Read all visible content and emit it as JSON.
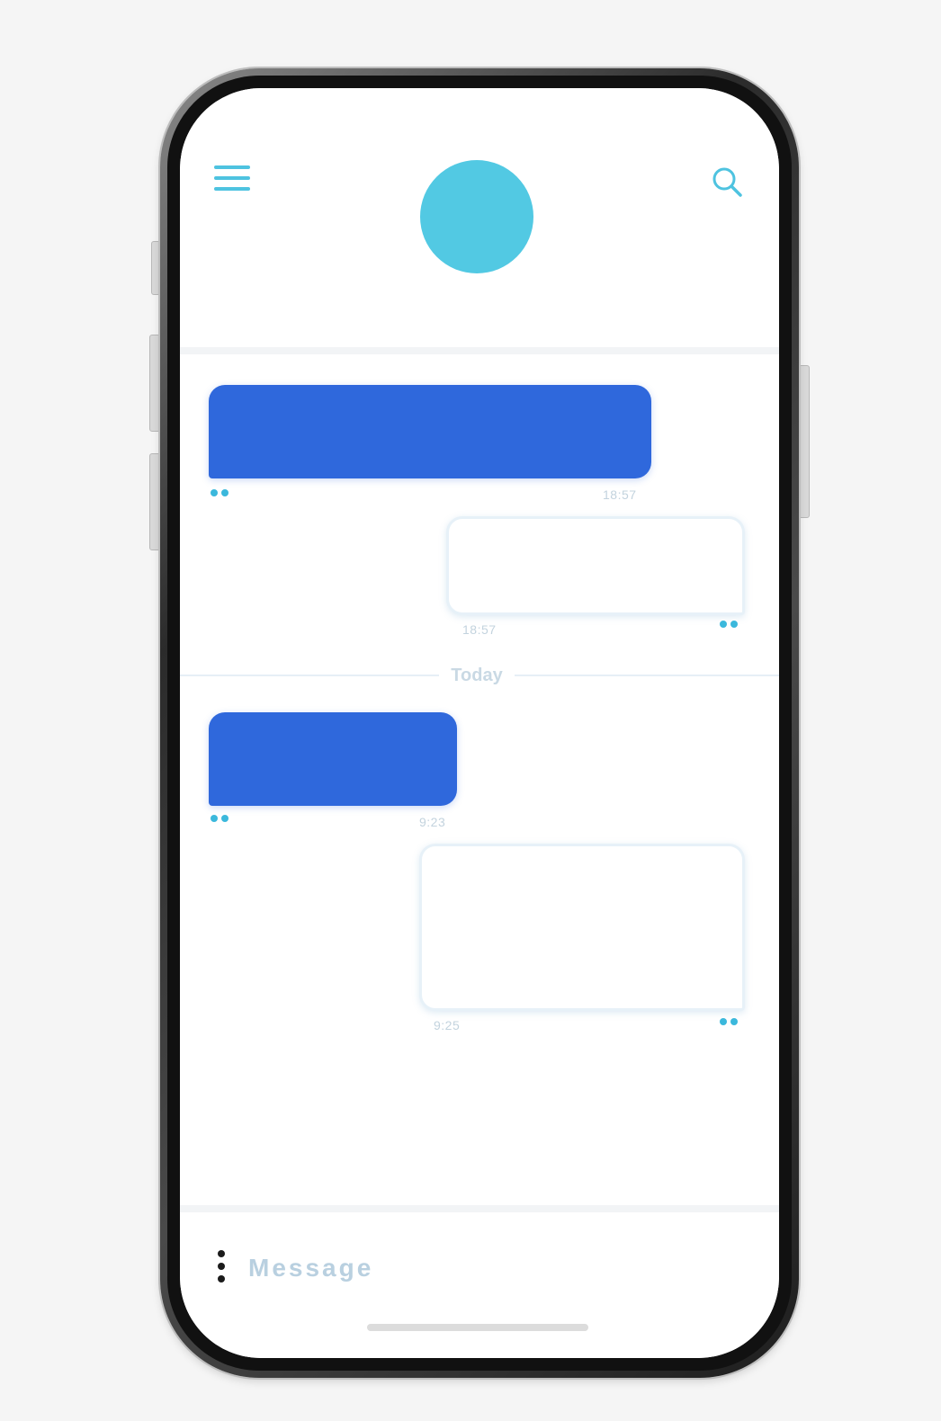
{
  "header": {
    "menu_icon": "menu-icon",
    "search_icon": "search-icon",
    "avatar_color": "#52c9e3"
  },
  "messages": [
    {
      "direction": "incoming",
      "time": "18:57",
      "color": "#2f68dc"
    },
    {
      "direction": "outgoing",
      "time": "18:57",
      "color": "#ffffff"
    },
    {
      "direction": "incoming",
      "time": "9:23",
      "color": "#2f68dc"
    },
    {
      "direction": "outgoing",
      "time": "9:25",
      "color": "#ffffff"
    }
  ],
  "separator": {
    "label": "Today"
  },
  "composer": {
    "more_icon": "vertical-dots-icon",
    "placeholder": "Message"
  },
  "colors": {
    "accent": "#4ec3e0",
    "incoming_bubble": "#2f68dc",
    "frame": "#2b2b2b"
  }
}
